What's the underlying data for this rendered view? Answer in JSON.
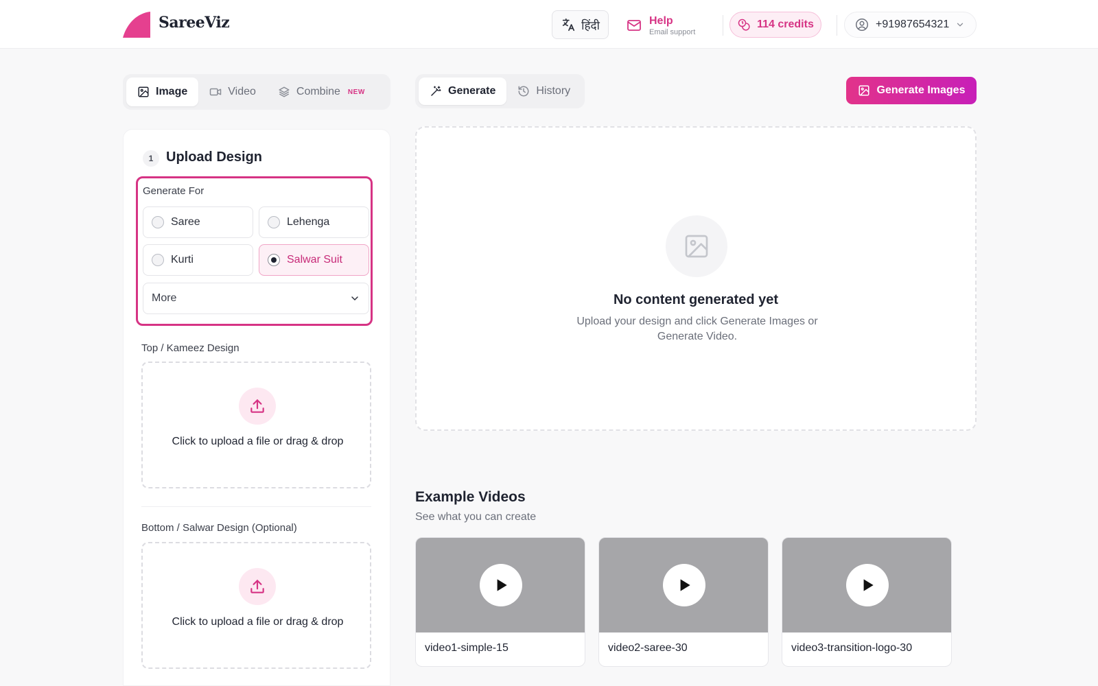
{
  "brand": {
    "name": "SareeViz",
    "accent": "#d63384"
  },
  "header": {
    "language_label": "हिंदी",
    "help_title": "Help",
    "help_subtitle": "Email support",
    "credits_label": "114 credits",
    "account_phone": "+91987654321"
  },
  "mode_tabs": [
    {
      "label": "Image",
      "icon": "image-icon",
      "active": true
    },
    {
      "label": "Video",
      "icon": "video-icon",
      "active": false
    },
    {
      "label": "Combine",
      "icon": "layers-icon",
      "badge": "NEW",
      "active": false
    }
  ],
  "view_tabs": [
    {
      "label": "Generate",
      "icon": "wand-icon",
      "active": true
    },
    {
      "label": "History",
      "icon": "history-icon",
      "active": false
    }
  ],
  "primary_action": {
    "label": "Generate Images"
  },
  "upload_section": {
    "step_number": "1",
    "title": "Upload Design",
    "generate_for_label": "Generate For",
    "options": [
      {
        "label": "Saree",
        "selected": false
      },
      {
        "label": "Lehenga",
        "selected": false
      },
      {
        "label": "Kurti",
        "selected": false
      },
      {
        "label": "Salwar Suit",
        "selected": true
      }
    ],
    "more_select": "More",
    "top_label": "Top / Kameez Design",
    "bottom_label": "Bottom / Salwar Design (Optional)",
    "dropzone_text": "Click to upload a file or drag & drop"
  },
  "preview": {
    "title": "No content generated yet",
    "subtitle": "Upload your design and click Generate Images or Generate Video."
  },
  "examples": {
    "title": "Example Videos",
    "subtitle": "See what you can create",
    "videos": [
      {
        "name": "video1-simple-15"
      },
      {
        "name": "video2-saree-30"
      },
      {
        "name": "video3-transition-logo-30"
      }
    ]
  }
}
